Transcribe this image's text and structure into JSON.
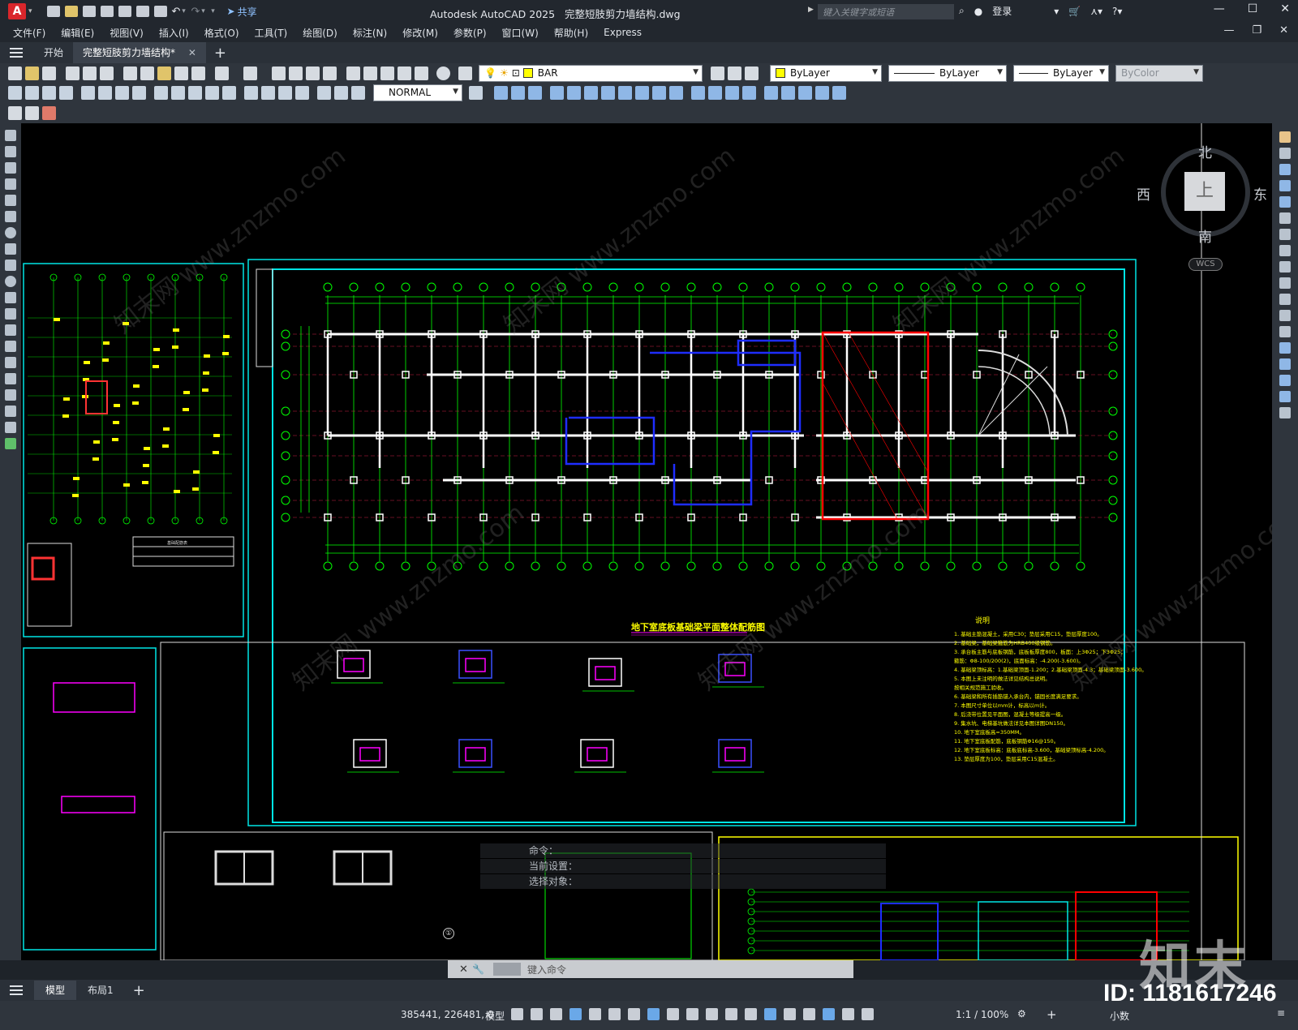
{
  "app": {
    "logo_letter": "A",
    "title": "Autodesk AutoCAD 2025",
    "filename": "完整短肢剪力墙结构.dwg",
    "share_label": "共享",
    "search_placeholder": "键入关键字或短语",
    "login_label": "登录"
  },
  "menu": [
    "文件(F)",
    "编辑(E)",
    "视图(V)",
    "插入(I)",
    "格式(O)",
    "工具(T)",
    "绘图(D)",
    "标注(N)",
    "修改(M)",
    "参数(P)",
    "窗口(W)",
    "帮助(H)",
    "Express"
  ],
  "tabs": {
    "start": "开始",
    "active": "完整短肢剪力墙结构*"
  },
  "properties": {
    "layer": "BAR",
    "color": "ByLayer",
    "linetype": "ByLayer",
    "lineweight": "ByLayer",
    "plotstyle": "ByColor",
    "dimstyle": "NORMAL"
  },
  "viewcube": {
    "north": "北",
    "south": "南",
    "east": "东",
    "west": "西",
    "face": "上",
    "wcs": "WCS"
  },
  "drawing": {
    "plan_title": "地下室底板基础梁平面整体配筋图",
    "notes_title": "说明",
    "notes": [
      "1. 基础主筋混凝土，采用C30；垫层采用C15，垫层厚度100。",
      "2. 基础梁，基础梁箍筋为HRB400级钢筋。",
      "3. 承台板主筋与底板钢筋，底板板厚度800，板面：上3Φ25；下3Φ25；",
      "   箍筋：Φ8-100/200(2)，底面标高：-4.200(-3.600)。",
      "4. 基础梁顶标高：1.基础梁顶面-1.200；2.基础梁顶面-4.3；基础梁顶面-3.600。",
      "5. 本图上未注明的做法详见结构总说明。",
      "   按相关规范施工验收。",
      "6. 基础梁和所有插筋锚入承台内，锚固长度满足要求。",
      "7. 本图尺寸单位以mm计，标高以m计。",
      "8. 后浇带位置见平面图，混凝土等级提高一级。",
      "9. 集水坑、电梯基坑做法详见本图详图DN150。",
      "10. 地下室底板高=350MM。",
      "11. 地下室底板配筋，底板钢筋Φ16@150。",
      "12. 地下室底板标高：底板底标高-3.600，基础梁顶标高-4.200。",
      "13. 垫层厚度为100，垫层采用C15混凝土。"
    ],
    "legend_title": "基础配筋表"
  },
  "command": {
    "history": [
      "命令：",
      "当前设置：",
      "选择对象："
    ],
    "placeholder": "键入命令"
  },
  "layouts": [
    "模型",
    "布局1"
  ],
  "status": {
    "coords": "385441, 226481, 0",
    "mode": "模型",
    "scale": "1:1 / 100%",
    "units": "小数"
  },
  "watermark": {
    "logo": "知末",
    "id": "ID: 1181617246",
    "diag": "知末网 www.znzmo.com"
  },
  "colors": {
    "canvas": "#000000",
    "frame": "#00e5e5",
    "grid": "#00ff00",
    "column": "#ffffff",
    "rebar": "#ffff00",
    "highlight_red": "#ff0000",
    "highlight_blue": "#1e2dff",
    "magenta": "#ff00ff"
  }
}
